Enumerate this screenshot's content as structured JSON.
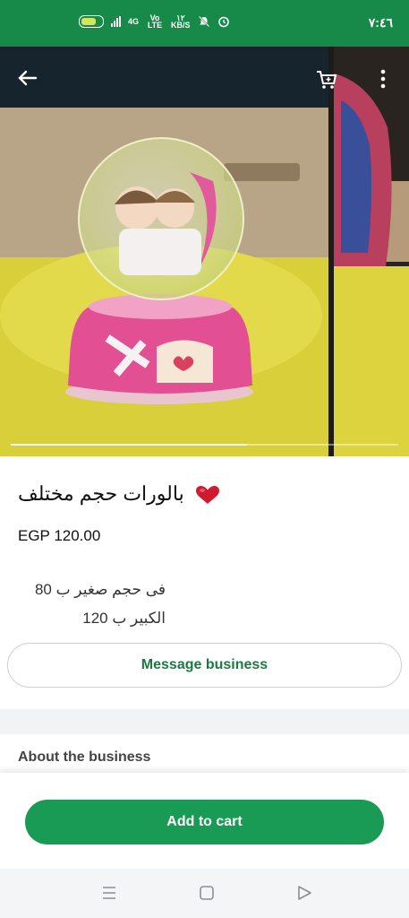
{
  "status_bar": {
    "time": "٧:٤٦",
    "battery": "5V",
    "net_4g": "4G",
    "volte": "Vo LTE",
    "speed": "١٢",
    "speed_unit": "KB/S"
  },
  "gallery": {
    "current_image": 1,
    "progress": 0.61
  },
  "product": {
    "title": "بالورات حجم مختلف",
    "price": "EGP 120.00",
    "description_line1": "فى حجم صغير ب 80",
    "description_line2": "الكبير ب 120"
  },
  "actions": {
    "message_business": "Message business",
    "add_to_cart": "Add to cart"
  },
  "about_section": {
    "heading": "About the business"
  },
  "colors": {
    "brand_green": "#178a4a",
    "button_green": "#1a9b55",
    "link_green": "#1a7a43"
  }
}
